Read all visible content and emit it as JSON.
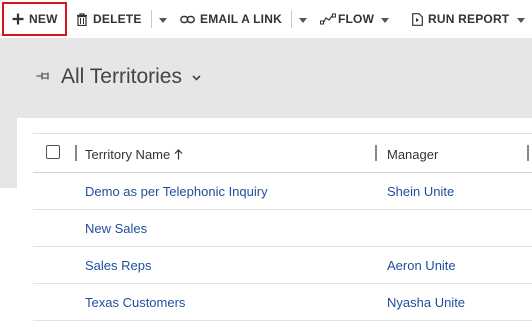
{
  "toolbar": {
    "new_label": "NEW",
    "delete_label": "DELETE",
    "email_label": "EMAIL A LINK",
    "flow_label": "FLOW",
    "report_label": "RUN REPORT"
  },
  "header": {
    "title": "All Territories"
  },
  "grid": {
    "columns": {
      "name": "Territory Name",
      "manager": "Manager"
    },
    "rows": [
      {
        "name": "Demo as per Telephonic Inquiry",
        "manager": "Shein Unite"
      },
      {
        "name": "New Sales",
        "manager": ""
      },
      {
        "name": "Sales Reps",
        "manager": "Aeron Unite"
      },
      {
        "name": "Texas Customers",
        "manager": "Nyasha Unite"
      }
    ]
  },
  "colors": {
    "highlight_border": "#d9121f",
    "link": "#1f4e9d",
    "header_bg": "#e6e6e6"
  }
}
